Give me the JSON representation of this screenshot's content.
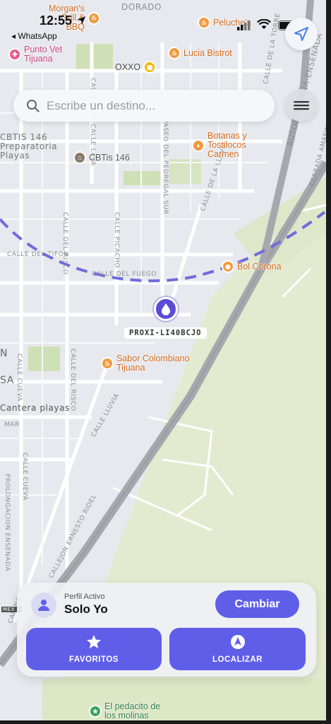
{
  "status": {
    "time": "12:55",
    "back_app": "◂ WhatsApp"
  },
  "search": {
    "placeholder": "Escribe un destino..."
  },
  "map": {
    "route_color": "#6f6bdc",
    "streets": [
      "CALLE DEL RISCO",
      "CALLE PICACHO",
      "CALLE DE LA LLUVIA",
      "CALLE LLUVIA",
      "CALLE DEL TIFON",
      "CALLE DEL FUEGO",
      "CALLE CUEVA",
      "CALLE DEL RISCO",
      "CALLE LLUVIA",
      "CALLE CUEVA",
      "PROLONGACION ENSENADA",
      "CALLEJON ERNESTO RIDEL",
      "MAR",
      "DORADO",
      "AUTOP. TIJUANA-ENSENADA",
      "CERRADA AMAFINITA",
      "CALLE DE LA TORRE",
      "PASEO DEL PEDREGAL SUR",
      "CALLE LAVA",
      "CALLE LUNA",
      "CAMINO",
      "MEX 1"
    ],
    "partial_labels": [
      "CBTIS 146",
      "Preparatoria",
      "Playas",
      "Cantera playas",
      "N",
      "SA"
    ],
    "pois": [
      {
        "name": "Morgan's Grill & BBQ",
        "icon": "restaurant-icon"
      },
      {
        "name": "Peluche's",
        "icon": "restaurant-icon"
      },
      {
        "name": "Punto Vet Tijuana",
        "icon": "vet-icon"
      },
      {
        "name": "Lucia Bistrot",
        "icon": "restaurant-icon"
      },
      {
        "name": "OXXO",
        "icon": "store-icon"
      },
      {
        "name": "Botanas y Tostilocos Carmen",
        "icon": "snack-icon"
      },
      {
        "name": "CBTis 146",
        "icon": "school-icon"
      },
      {
        "name": "Bol Corona",
        "icon": "bowling-icon"
      },
      {
        "name": "Sabor Colombiano Tijuana",
        "icon": "restaurant-icon"
      },
      {
        "name": "El pedacito de los molinas",
        "icon": "park-icon"
      }
    ],
    "user_marker_label": "PROXI-LI40BCJO"
  },
  "panel": {
    "profile_label": "Perfil Activo",
    "profile_name": "Solo Yo",
    "change_button": "Cambiar",
    "favorites_button": "FAVORITOS",
    "locate_button": "LOCALIZAR"
  }
}
